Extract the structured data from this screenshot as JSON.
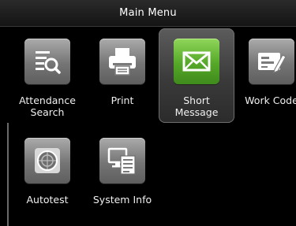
{
  "header": {
    "title": "Main Menu"
  },
  "menu": {
    "items": [
      {
        "line1": "Attendance",
        "line2": "Search",
        "icon": "attendance-search-icon"
      },
      {
        "line1": "Print",
        "line2": "",
        "icon": "printer-icon"
      },
      {
        "line1": "Short",
        "line2": "Message",
        "icon": "envelope-icon",
        "selected": true
      },
      {
        "line1": "Work Code",
        "line2": "",
        "icon": "work-code-icon"
      },
      {
        "line1": "Autotest",
        "line2": "",
        "icon": "autotest-icon"
      },
      {
        "line1": "System Info",
        "line2": "",
        "icon": "system-info-icon"
      }
    ]
  },
  "colors": {
    "background": "#000000",
    "selected_tile": "#55a828",
    "tile_gray": "#8a8a8a"
  }
}
